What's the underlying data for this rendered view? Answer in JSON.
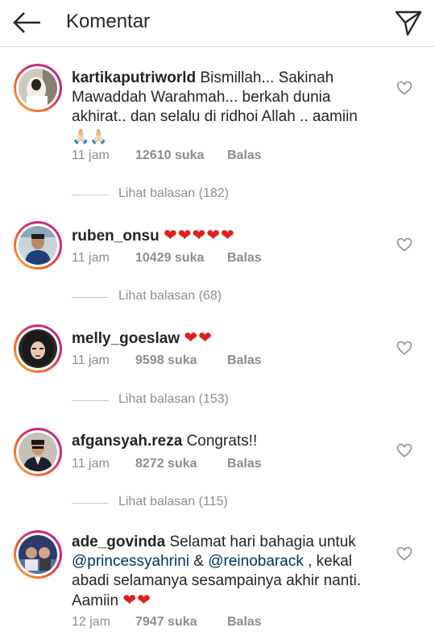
{
  "header": {
    "title": "Komentar",
    "back_icon": "arrow-left-icon",
    "send_icon": "paper-plane-icon"
  },
  "comments": [
    {
      "username": "kartikaputriworld",
      "text": "Bismillah... Sakinah Mawaddah Warahmah... berkah dunia akhirat.. dan selalu di ridhoi Allah .. aamiin",
      "emoji": "🙏🏻🙏🏻",
      "time": "11 jam",
      "likes": "12610 suka",
      "reply_label": "Balas",
      "view_replies": "Lihat balasan (182)"
    },
    {
      "username": "ruben_onsu",
      "text": "",
      "emoji": "❤❤❤❤❤",
      "time": "11 jam",
      "likes": "10429 suka",
      "reply_label": "Balas",
      "view_replies": "Lihat balasan (68)"
    },
    {
      "username": "melly_goeslaw",
      "text": "",
      "emoji": "❤❤",
      "time": "11 jam",
      "likes": "9598 suka",
      "reply_label": "Balas",
      "view_replies": "Lihat balasan (153)"
    },
    {
      "username": "afgansyah.reza",
      "text": "Congrats!!",
      "emoji": "",
      "time": "11 jam",
      "likes": "8272 suka",
      "reply_label": "Balas",
      "view_replies": "Lihat balasan (115)"
    },
    {
      "username": "ade_govinda",
      "text": "Selamat hari bahagia untuk",
      "mention1": "@princessyahrini",
      "amp": " & ",
      "mention2": "@reinobarack",
      "text2": ", kekal abadi selamanya sesampainya akhir nanti. Aamiin",
      "emoji": "❤❤",
      "time": "12 jam",
      "likes": "7947 suka",
      "reply_label": "Balas"
    }
  ],
  "colors": {
    "heart_red": "#e0201c",
    "meta_gray": "#8e8e8e",
    "mention_blue": "#003569"
  }
}
